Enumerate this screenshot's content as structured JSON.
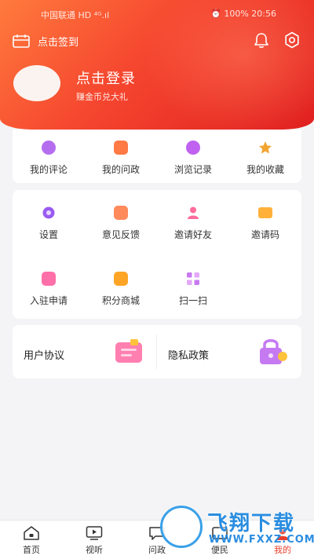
{
  "status_bar": {
    "carrier": "中国联通 HD ⁴ᴳ.ıl",
    "right": "⏰ 100% 20:56"
  },
  "header": {
    "signin_label": "点击签到",
    "login_title": "点击登录",
    "login_subtitle": "赚金币兑大礼"
  },
  "quick_menu": [
    {
      "label": "我的评论",
      "icon": "comment-icon",
      "color": "#b56df0"
    },
    {
      "label": "我的问政",
      "icon": "question-icon",
      "color": "#ff7a45"
    },
    {
      "label": "浏览记录",
      "icon": "history-icon",
      "color": "#c061f0"
    },
    {
      "label": "我的收藏",
      "icon": "star-icon",
      "color": "#f2a531"
    }
  ],
  "tools_menu": [
    {
      "label": "设置",
      "icon": "settings-icon",
      "color": "#9a5bf2"
    },
    {
      "label": "意见反馈",
      "icon": "feedback-icon",
      "color": "#ff8a5b"
    },
    {
      "label": "邀请好友",
      "icon": "invite-friend-icon",
      "color": "#ff6b9a"
    },
    {
      "label": "邀请码",
      "icon": "invite-code-icon",
      "color": "#ffb13b"
    },
    {
      "label": "入驻申请",
      "icon": "apply-icon",
      "color": "#ff6fa8"
    },
    {
      "label": "积分商城",
      "icon": "points-mall-icon",
      "color": "#ffa526"
    },
    {
      "label": "扫一扫",
      "icon": "scan-icon",
      "color": "#c87af0"
    }
  ],
  "policies": {
    "user_agreement": "用户协议",
    "privacy_policy": "隐私政策"
  },
  "bottom_nav": [
    {
      "label": "首页",
      "icon": "home-icon"
    },
    {
      "label": "视听",
      "icon": "video-icon"
    },
    {
      "label": "问政",
      "icon": "chat-icon"
    },
    {
      "label": "便民",
      "icon": "service-icon"
    },
    {
      "label": "我的",
      "icon": "profile-icon"
    }
  ],
  "watermark": {
    "title": "飞翔下载",
    "url": "WWW.FXXZ.COM"
  },
  "colors": {
    "brand": "#e8402f",
    "header_start": "#ff7a3d",
    "header_end": "#e02020"
  }
}
